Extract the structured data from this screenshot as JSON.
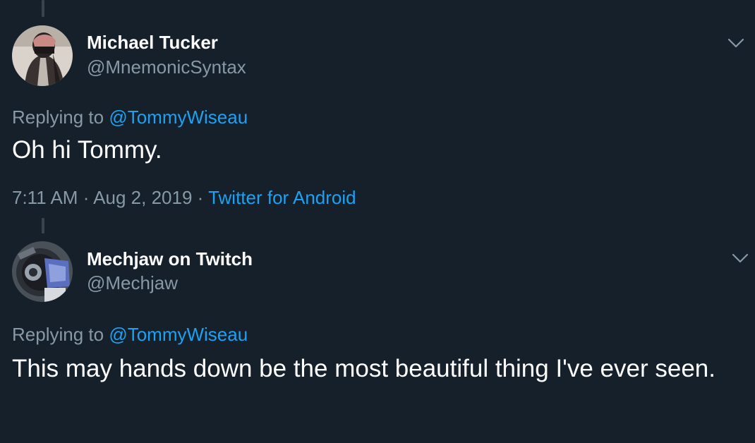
{
  "tweets": [
    {
      "display_name": "Michael Tucker",
      "handle": "@MnemonicSyntax",
      "replying_prefix": "Replying to",
      "replying_to": "@TommyWiseau",
      "text": "Oh hi Tommy.",
      "time": "7:11 AM",
      "separator": "·",
      "date": "Aug 2, 2019",
      "source": "Twitter for Android",
      "avatar_icon": "profile-photo-masked-figure"
    },
    {
      "display_name": "Mechjaw on Twitch",
      "handle": "@Mechjaw",
      "replying_prefix": "Replying to",
      "replying_to": "@TommyWiseau",
      "text": "This may hands down be the most beautiful thing I've ever seen.",
      "avatar_icon": "profile-photo-robot-helmet"
    }
  ],
  "colors": {
    "background": "#15202b",
    "primary_text": "#ffffff",
    "secondary_text": "#8899a6",
    "link": "#1da1f2",
    "thread_line": "#38444d"
  },
  "icons": {
    "more_menu": "chevron-down-icon"
  }
}
